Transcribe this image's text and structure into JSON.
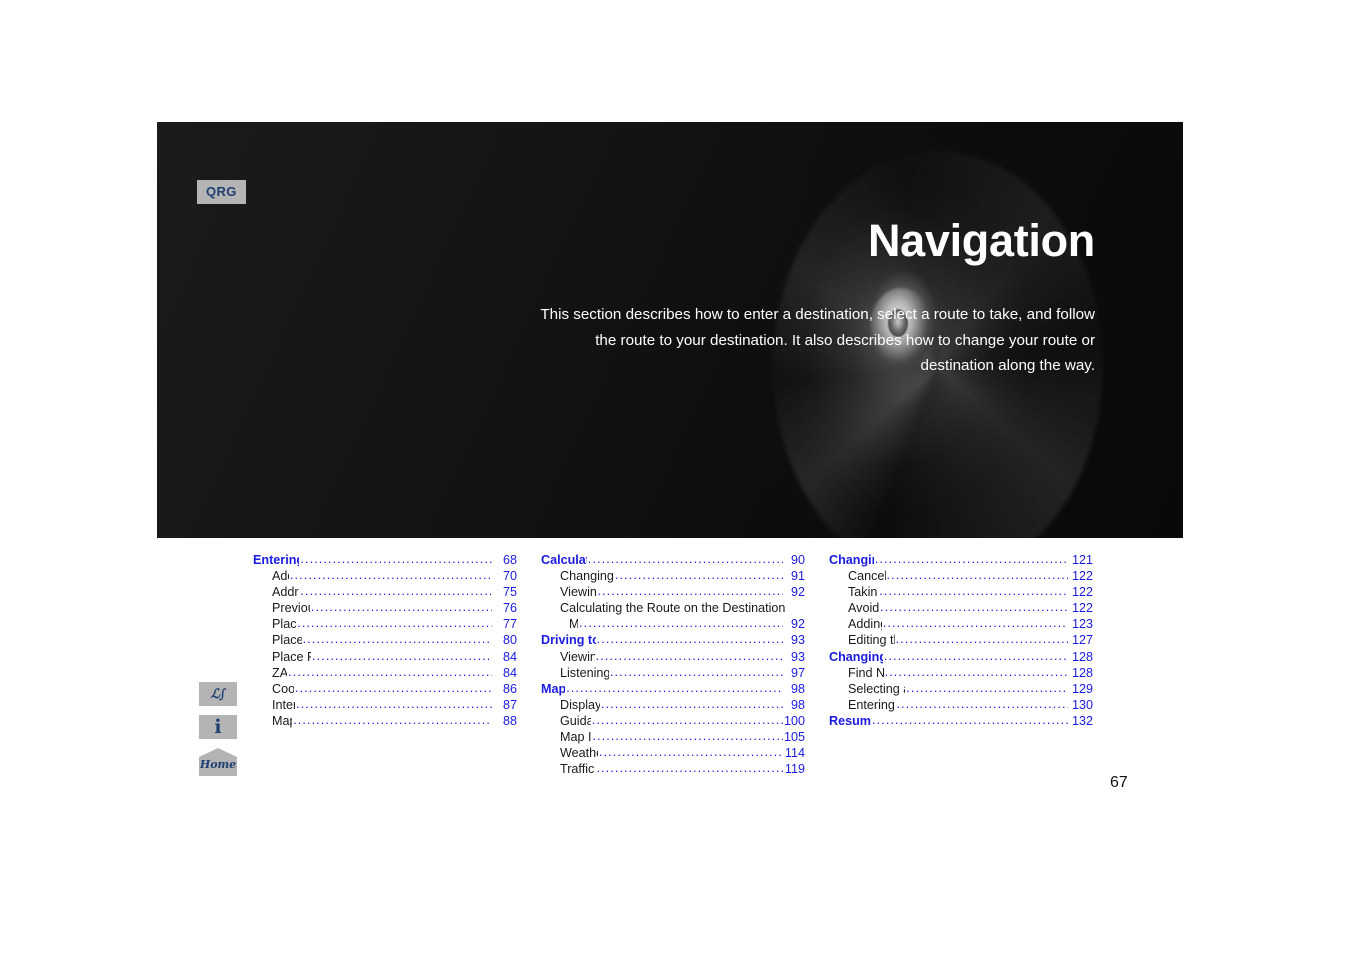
{
  "hero": {
    "badge": "QRG",
    "title": "Navigation",
    "description": "This section describes how to enter a destination, select a route to take, and follow the route to your destination. It also describes how to change your route or destination along the way."
  },
  "icon_rail": [
    {
      "name": "voice-command-icon",
      "glyph": "ℒ∫"
    },
    {
      "name": "information-icon",
      "glyph": "i"
    },
    {
      "name": "home-icon",
      "glyph": "Home"
    }
  ],
  "folio": "67",
  "colors": {
    "heading_blue": "#1a1ae1",
    "badge_blue": "#1f3f73",
    "badge_gray": "#b4b4b4",
    "body_text": "#1a1a1a",
    "hero_background": "#111111"
  },
  "toc": {
    "columns": [
      {
        "entries": [
          {
            "type": "heading",
            "label": "Entering a Destination",
            "page": "68"
          },
          {
            "type": "sub",
            "label": "Address",
            "page": "70"
          },
          {
            "type": "sub",
            "label": "Address Book",
            "page": "75"
          },
          {
            "type": "sub",
            "label": "Previous Destination",
            "page": "76"
          },
          {
            "type": "sub",
            "label": "Place Name",
            "page": "77"
          },
          {
            "type": "sub",
            "label": "Place Category",
            "page": "80"
          },
          {
            "type": "sub",
            "label": "Place Phone Number",
            "page": "84"
          },
          {
            "type": "sub",
            "label": "ZAGAT",
            "page": "84"
          },
          {
            "type": "sub",
            "label": "Coordinate",
            "page": "86"
          },
          {
            "type": "sub",
            "label": "Intersection",
            "page": "87"
          },
          {
            "type": "sub",
            "label": "Map Input",
            "page": "88"
          }
        ]
      },
      {
        "entries": [
          {
            "type": "heading",
            "label": "Calculating the Route",
            "page": "90"
          },
          {
            "type": "sub",
            "label": "Changing the Route Preference",
            "page": "91"
          },
          {
            "type": "sub",
            "label": "Viewing the Routes",
            "page": "92"
          },
          {
            "type": "cont",
            "label": "Calculating the Route on the Destination",
            "page": ""
          },
          {
            "type": "wrapped",
            "label": "Map",
            "page": "92"
          },
          {
            "type": "heading",
            "label": "Driving to Your Destination",
            "page": "93"
          },
          {
            "type": "sub",
            "label": "Viewing the Route",
            "page": "93"
          },
          {
            "type": "sub",
            "label": "Listening to Voice Guidance",
            "page": "97"
          },
          {
            "type": "heading",
            "label": "Map Menu",
            "page": "98"
          },
          {
            "type": "sub",
            "label": "Displaying Map Menu",
            "page": "98"
          },
          {
            "type": "sub",
            "label": "Guidance Menu",
            "page": "100"
          },
          {
            "type": "sub",
            "label": "Map Information",
            "page": "105"
          },
          {
            "type": "sub",
            "label": "Weather Information",
            "page": "114"
          },
          {
            "type": "sub",
            "label": "Traffic Rerouting™",
            "page": "119"
          }
        ]
      },
      {
        "entries": [
          {
            "type": "heading",
            "label": "Changing Your Route",
            "page": "121"
          },
          {
            "type": "sub",
            "label": "Canceling the Route",
            "page": "122"
          },
          {
            "type": "sub",
            "label": "Taking a Detour",
            "page": "122"
          },
          {
            "type": "sub",
            "label": "Avoiding Streets",
            "page": "122"
          },
          {
            "type": "sub",
            "label": "Adding Waypoints",
            "page": "123"
          },
          {
            "type": "sub",
            "label": "Editing the Destination List",
            "page": "127"
          },
          {
            "type": "heading",
            "label": "Changing Your Destination",
            "page": "128"
          },
          {
            "type": "sub",
            "label": "Find Nearest Place",
            "page": "128"
          },
          {
            "type": "sub",
            "label": "Selecting a Destination on the Map",
            "page": "129"
          },
          {
            "type": "sub",
            "label": "Entering a New Destination",
            "page": "130"
          },
          {
            "type": "heading",
            "label": "Resuming Your Trip",
            "page": "132"
          }
        ]
      }
    ]
  }
}
